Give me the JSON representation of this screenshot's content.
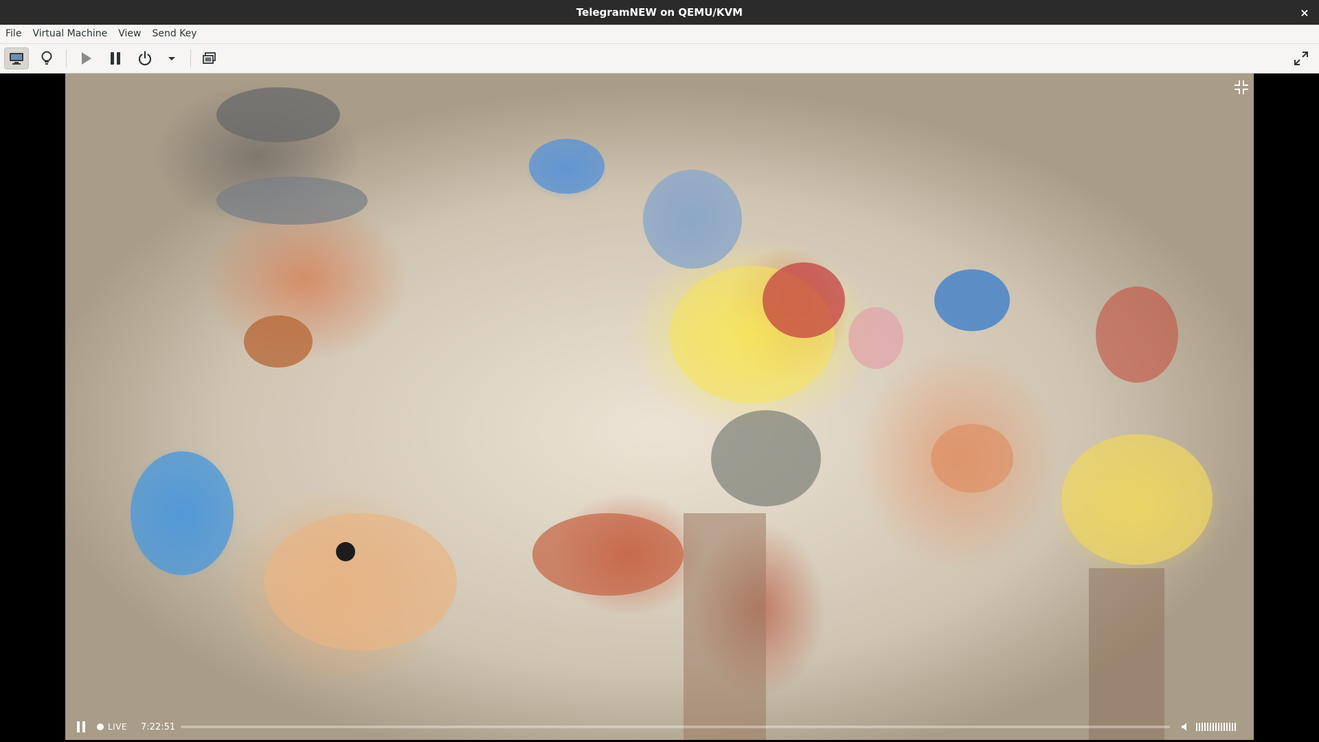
{
  "window": {
    "title": "TelegramNEW on QEMU/KVM",
    "close_symbol": "×"
  },
  "menubar": {
    "items": [
      "File",
      "Virtual Machine",
      "View",
      "Send Key"
    ]
  },
  "toolbar": {
    "buttons": [
      {
        "name": "console-view",
        "icon": "monitor-icon",
        "active": true
      },
      {
        "name": "details-view",
        "icon": "lightbulb-icon",
        "active": false
      },
      {
        "name": "run",
        "icon": "play-icon",
        "active": false
      },
      {
        "name": "pause",
        "icon": "pause-icon",
        "active": false
      },
      {
        "name": "shutdown",
        "icon": "power-icon",
        "active": false
      },
      {
        "name": "shutdown-menu",
        "icon": "chevron-down-icon",
        "active": false
      },
      {
        "name": "snapshots",
        "icon": "snapshot-icon",
        "active": false
      },
      {
        "name": "fullscreen",
        "icon": "fullscreen-icon",
        "active": false
      }
    ]
  },
  "video": {
    "live_label": "LIVE",
    "time": "7:22:51",
    "progress_fraction": 0.0,
    "colors": {
      "yellow": "#f4e35a",
      "blue": "#5096d7",
      "orange": "#d7784b"
    }
  }
}
